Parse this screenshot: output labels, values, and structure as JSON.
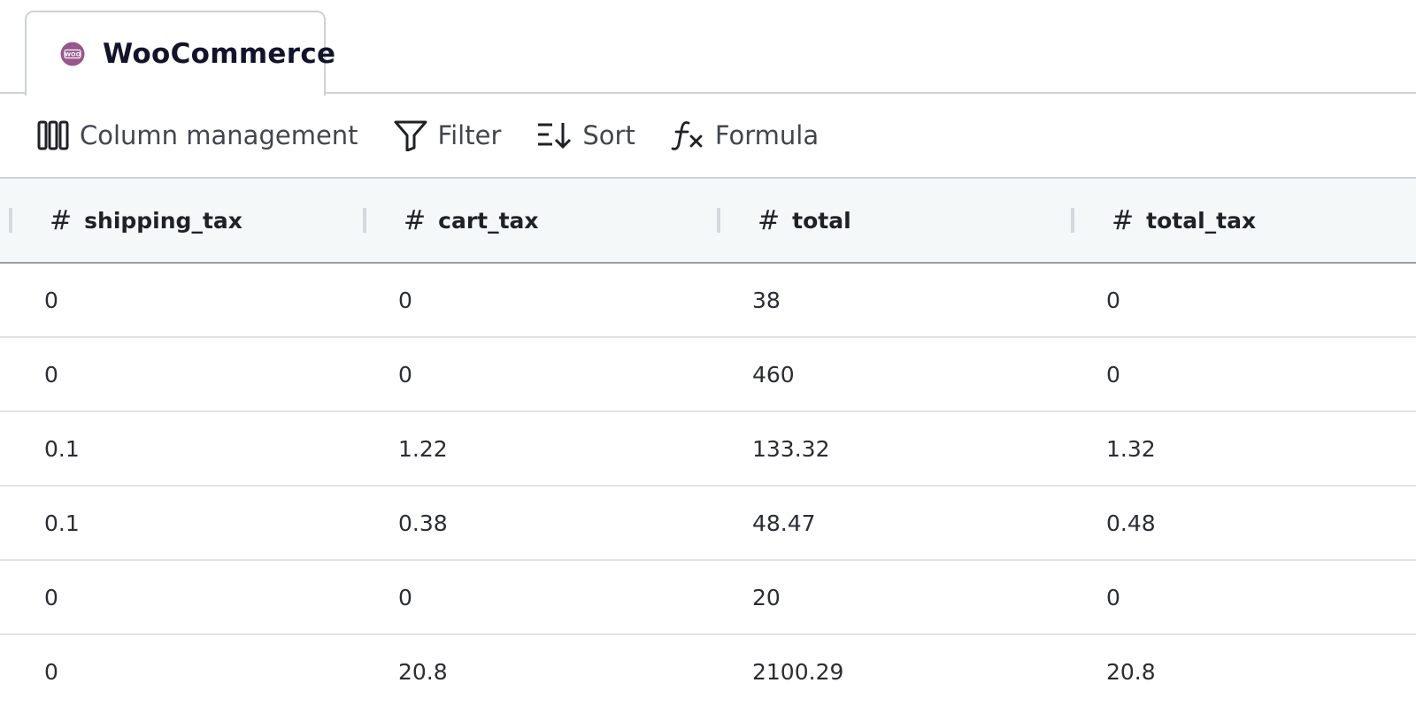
{
  "tab": {
    "label": "WooCommerce",
    "icon": "woocommerce-logo-icon",
    "icon_text": "WOO",
    "icon_color": "#96588a"
  },
  "toolbar": {
    "column_management_label": "Column management",
    "filter_label": "Filter",
    "sort_label": "Sort",
    "formula_label": "Formula"
  },
  "table": {
    "columns": [
      {
        "type_symbol": "#",
        "name": "shipping_tax"
      },
      {
        "type_symbol": "#",
        "name": "cart_tax"
      },
      {
        "type_symbol": "#",
        "name": "total"
      },
      {
        "type_symbol": "#",
        "name": "total_tax"
      }
    ],
    "rows": [
      [
        "0",
        "0",
        "38",
        "0"
      ],
      [
        "0",
        "0",
        "460",
        "0"
      ],
      [
        "0.1",
        "1.22",
        "133.32",
        "1.32"
      ],
      [
        "0.1",
        "0.38",
        "48.47",
        "0.48"
      ],
      [
        "0",
        "0",
        "20",
        "0"
      ],
      [
        "0",
        "20.8",
        "2100.29",
        "20.8"
      ]
    ]
  }
}
